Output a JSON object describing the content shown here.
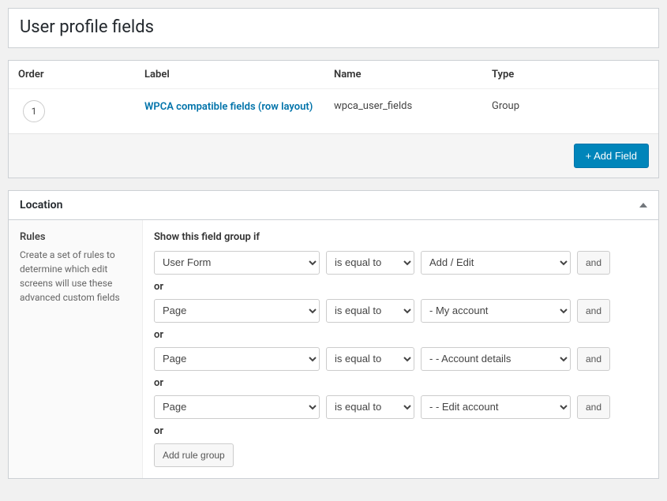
{
  "title": "User profile fields",
  "fields_table": {
    "headers": {
      "order": "Order",
      "label": "Label",
      "name": "Name",
      "type": "Type"
    },
    "rows": [
      {
        "order": "1",
        "label": "WPCA compatible fields (row layout)",
        "name": "wpca_user_fields",
        "type": "Group"
      }
    ],
    "add_field_label": "+ Add Field"
  },
  "location": {
    "heading": "Location",
    "sidebar_title": "Rules",
    "sidebar_desc": "Create a set of rules to determine which edit screens will use these advanced custom fields",
    "rules_title": "Show this field group if",
    "or_label": "or",
    "and_label": "and",
    "add_rule_group_label": "Add rule group",
    "rules": [
      {
        "param": "User Form",
        "op": "is equal to",
        "val": "Add / Edit"
      },
      {
        "param": "Page",
        "op": "is equal to",
        "val": "- My account"
      },
      {
        "param": "Page",
        "op": "is equal to",
        "val": "- - Account details"
      },
      {
        "param": "Page",
        "op": "is equal to",
        "val": "- - Edit account"
      }
    ]
  }
}
